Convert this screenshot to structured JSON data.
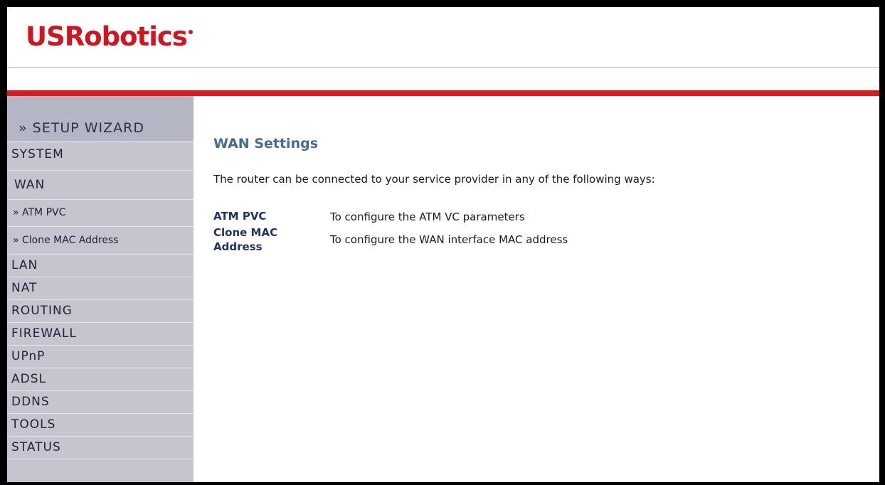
{
  "brand": {
    "name": "USRobotics",
    "accent": "#d6121f",
    "bar_color": "#e0181d"
  },
  "sidebar": {
    "wizard_label": "» SETUP WIZARD",
    "items": [
      {
        "label": "SYSTEM"
      },
      {
        "label": "WAN"
      },
      {
        "label": "» ATM PVC"
      },
      {
        "label": "» Clone MAC Address"
      },
      {
        "label": "LAN"
      },
      {
        "label": "NAT"
      },
      {
        "label": "ROUTING"
      },
      {
        "label": "FIREWALL"
      },
      {
        "label": "UPnP"
      },
      {
        "label": "ADSL"
      },
      {
        "label": "DDNS"
      },
      {
        "label": "TOOLS"
      },
      {
        "label": "STATUS"
      }
    ]
  },
  "main": {
    "title": "WAN Settings",
    "intro": "The router can be connected to your service provider in any of the following ways:",
    "options": [
      {
        "label": "ATM PVC",
        "description": "To configure the ATM VC parameters"
      },
      {
        "label": "Clone MAC Address",
        "description": "To configure the WAN interface MAC address"
      }
    ]
  }
}
